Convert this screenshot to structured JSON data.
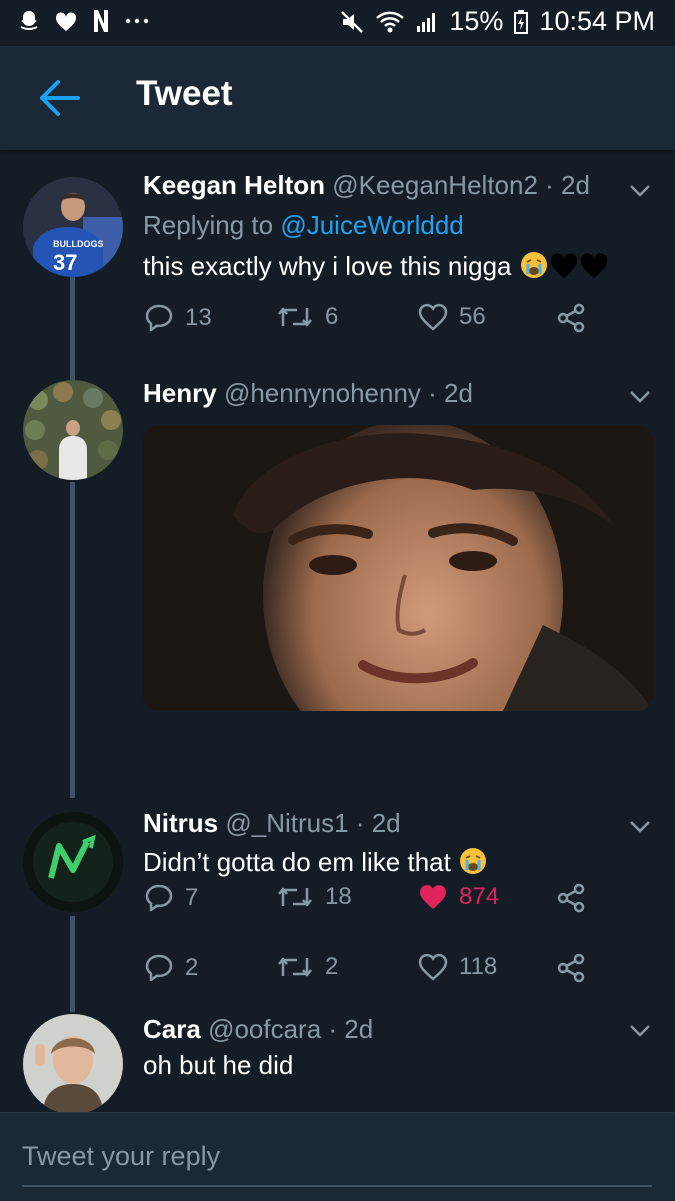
{
  "status_bar": {
    "battery": "15%",
    "time": "10:54 PM",
    "left_icons": [
      "snapchat-icon",
      "heart-icon",
      "netflix-icon",
      "more-dots-icon"
    ],
    "right_icons": [
      "mute-icon",
      "wifi-icon",
      "signal-icon",
      "battery-icon"
    ]
  },
  "app_bar": {
    "title": "Tweet",
    "back_icon": "back-arrow-icon",
    "accent": "#1da1f2"
  },
  "tweets": [
    {
      "name": "Keegan Helton",
      "handle": "@KeeganHelton2",
      "sep": " · ",
      "age": "2d",
      "replying_prefix": "Replying to ",
      "replying_to": "@JuiceWorlddd",
      "text": "this exactly why i love this nigga",
      "emojis": [
        "crying-face-emoji",
        "black-heart-emoji",
        "black-heart-emoji"
      ],
      "replies": "13",
      "retweets": "6",
      "likes": "56",
      "liked": false
    },
    {
      "name": "Henry",
      "handle": "@hennynohenny",
      "sep": " · ",
      "age": "2d",
      "has_media": true,
      "replies": "7",
      "retweets": "18",
      "likes": "874",
      "liked": true
    },
    {
      "name": "Nitrus",
      "handle": "@_Nitrus1",
      "sep": " · ",
      "age": "2d",
      "text": "Didn’t gotta do em like that",
      "emojis": [
        "crying-face-emoji"
      ],
      "replies": "2",
      "retweets": "2",
      "likes": "118",
      "liked": false
    },
    {
      "name": "Cara",
      "handle": "@oofcara",
      "sep": " · ",
      "age": "2d",
      "text": "oh but he did"
    }
  ],
  "composer": {
    "placeholder": "Tweet your reply"
  },
  "colors": {
    "background": "#141d26",
    "app_bar": "#1b2836",
    "secondary_text": "#8899a6",
    "like": "#e0245e",
    "thread_line": "#3f5364"
  }
}
